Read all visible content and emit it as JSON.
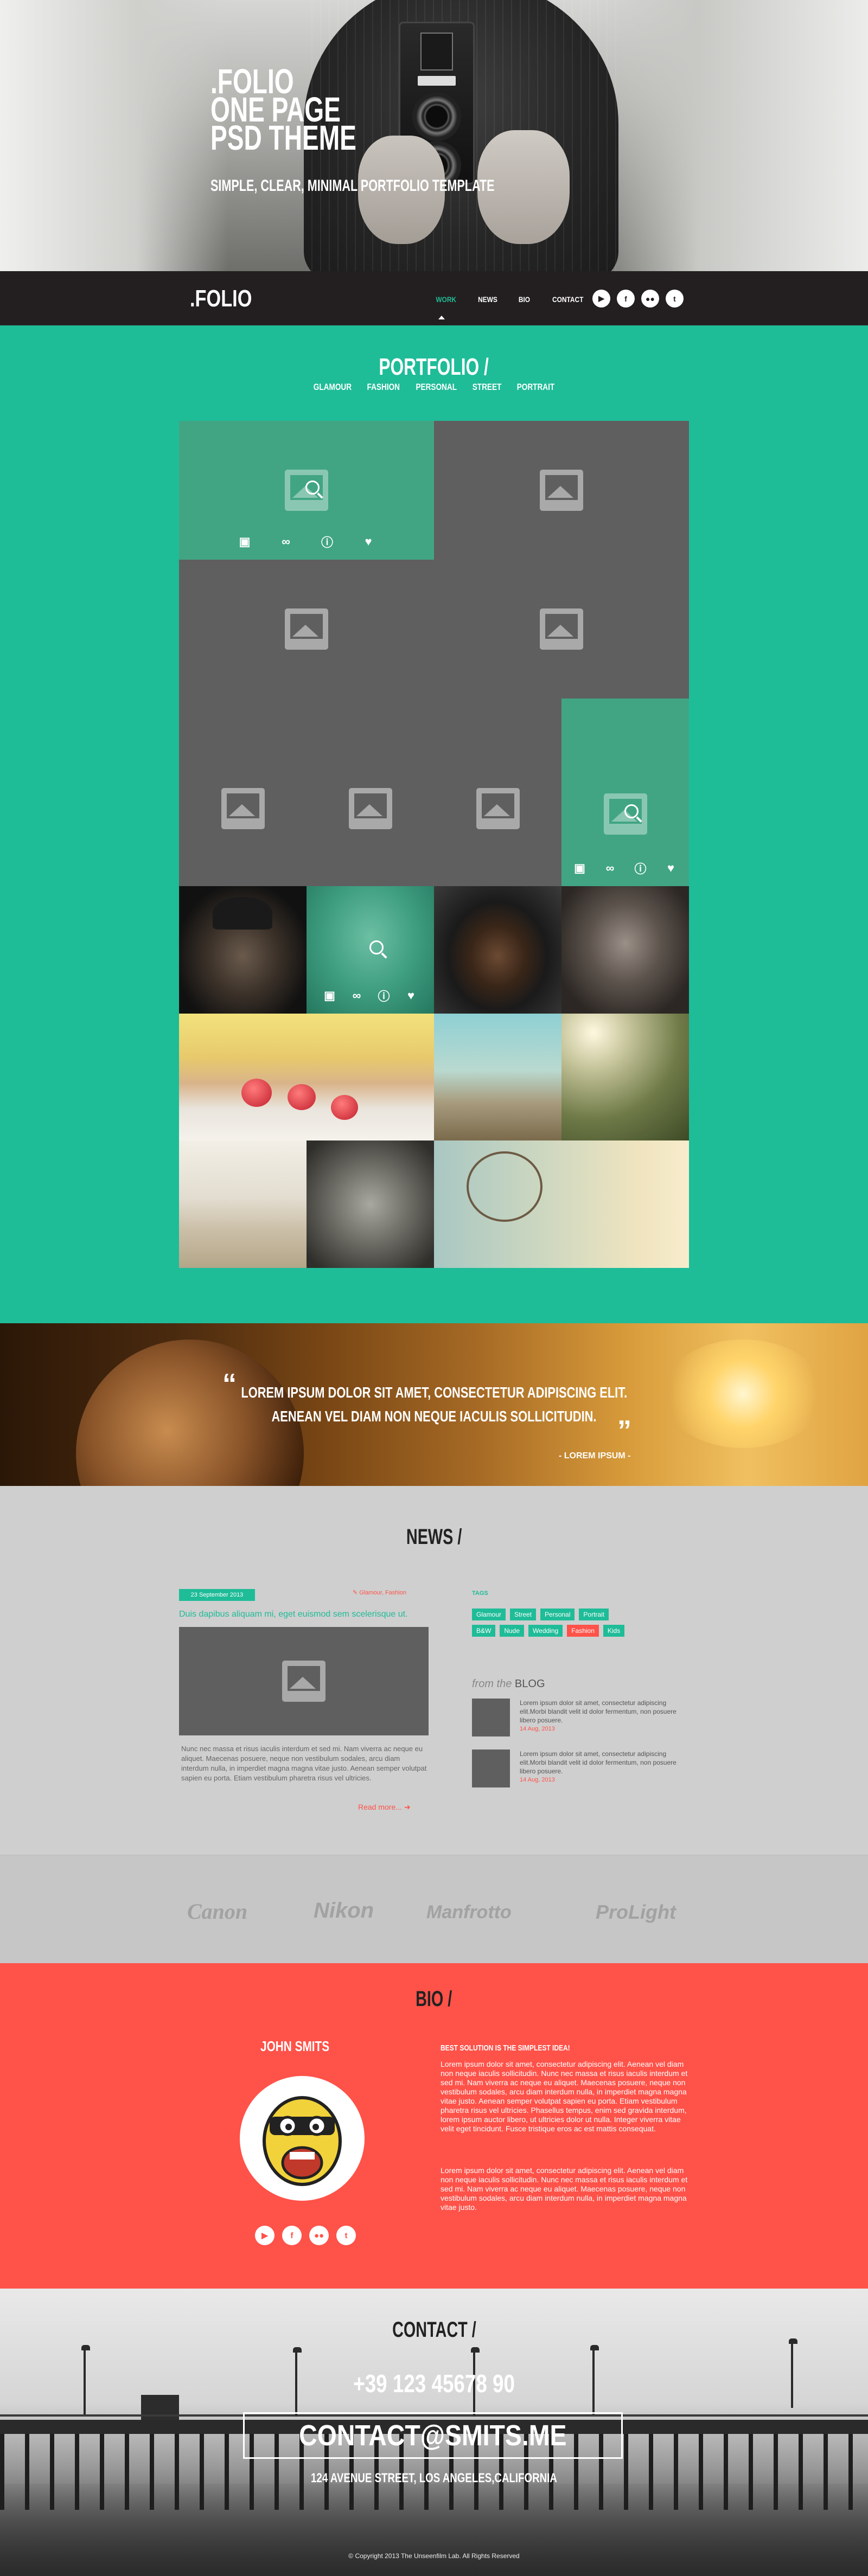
{
  "hero": {
    "title_line1": ".FOLIO",
    "title_line2": "ONE PAGE",
    "title_line3": "PSD THEME",
    "subtitle": "SIMPLE, CLEAR, MINIMAL PORTFOLIO TEMPLATE"
  },
  "nav": {
    "logo": ".FOLIO",
    "items": [
      "WORK",
      "NEWS",
      "BIO",
      "CONTACT"
    ],
    "active": "WORK",
    "socials": [
      "youtube-icon",
      "facebook-icon",
      "flickr-icon",
      "twitter-icon"
    ]
  },
  "portfolio": {
    "title": "PORTFOLIO /",
    "filters": [
      "GLAMOUR",
      "FASHION",
      "PERSONAL",
      "STREET",
      "PORTRAIT"
    ],
    "item_actions": [
      "gallery-icon",
      "link-icon",
      "info-icon",
      "heart-icon"
    ]
  },
  "quote": {
    "line1": "LOREM IPSUM DOLOR SIT AMET, CONSECTETUR ADIPISCING ELIT.",
    "line2": "AENEAN VEL DIAM NON NEQUE IACULIS SOLLICITUDIN.",
    "author": "- LOREM IPSUM -"
  },
  "news": {
    "title": "NEWS /",
    "post": {
      "date": "23 September 2013",
      "tags": "Glamour, Fashion",
      "title": "Duis dapibus aliquam mi, eget euismod sem scelerisque ut.",
      "text": "Nunc nec massa et risus iaculis interdum et sed mi. Nam viverra ac neque eu aliquet. Maecenas posuere, neque non vestibulum sodales, arcu diam interdum nulla, in imperdiet magna magna vitae justo. Aenean semper volutpat sapien eu porta. Etiam vestibulum pharetra risus vel ultricies.",
      "read_more": "Read more..."
    },
    "tags_label": "TAGS",
    "tags": [
      "Glamour",
      "Street",
      "Personal",
      "Portrait",
      "B&W",
      "Nude",
      "Wedding",
      "Fashion",
      "Kids"
    ],
    "hot_tag": "Fashion",
    "blog_prefix": "from the",
    "blog_label": "BLOG",
    "blog_items": [
      {
        "text": "Lorem ipsum dolor sit amet, consectetur adipiscing elit.Morbi blandit velit id dolor fermentum, non posuere libero posuere.",
        "date": "14 Aug, 2013"
      },
      {
        "text": "Lorem ipsum dolor sit amet, consectetur adipiscing elit.Morbi blandit velit id dolor fermentum, non posuere libero posuere.",
        "date": "14 Aug, 2013"
      }
    ]
  },
  "brands": [
    "Canon",
    "Nikon",
    "Manfrotto",
    "ProLight"
  ],
  "bio": {
    "title": "BIO /",
    "name": "JOHN SMITS",
    "heading": "BEST SOLUTION IS THE SIMPLEST IDEA!",
    "para1": "Lorem ipsum dolor sit amet, consectetur adipiscing elit. Aenean vel diam non neque iaculis sollicitudin. Nunc nec massa et risus iaculis interdum et sed mi. Nam viverra ac neque eu aliquet. Maecenas posuere, neque non vestibulum sodales, arcu diam interdum nulla, in imperdiet magna magna vitae justo. Aenean semper volutpat sapien eu porta. Etiam vestibulum pharetra risus vel ultricies. Phasellus tempus, enim sed gravida interdum, lorem ipsum auctor libero, ut ultricies dolor ut nulla. Integer viverra vitae velit eget tincidunt. Fusce tristique eros ac est mattis consequat.",
    "para2": "Lorem ipsum dolor sit amet, consectetur adipiscing elit. Aenean vel diam non neque iaculis sollicitudin. Nunc nec massa et risus iaculis interdum et sed mi. Nam viverra ac neque eu aliquet. Maecenas posuere, neque non vestibulum sodales, arcu diam interdum nulla, in imperdiet magna magna vitae justo.",
    "socials": [
      "youtube-icon",
      "facebook-icon",
      "flickr-icon",
      "twitter-icon"
    ]
  },
  "contact": {
    "title": "CONTACT /",
    "phone": "+39 123 45678 90",
    "email": "CONTACT@SMITS.ME",
    "address": "124 AVENUE STREET, LOS ANGELES,CALIFORNIA",
    "copyright": "© Copyright 2013 The Unseenfilm Lab. All Rights Reserved"
  },
  "colors": {
    "accent_green": "#1fbc98",
    "accent_red": "#ff5249",
    "nav_bg": "#231f20",
    "placeholder_gray": "#5f5f5f"
  }
}
